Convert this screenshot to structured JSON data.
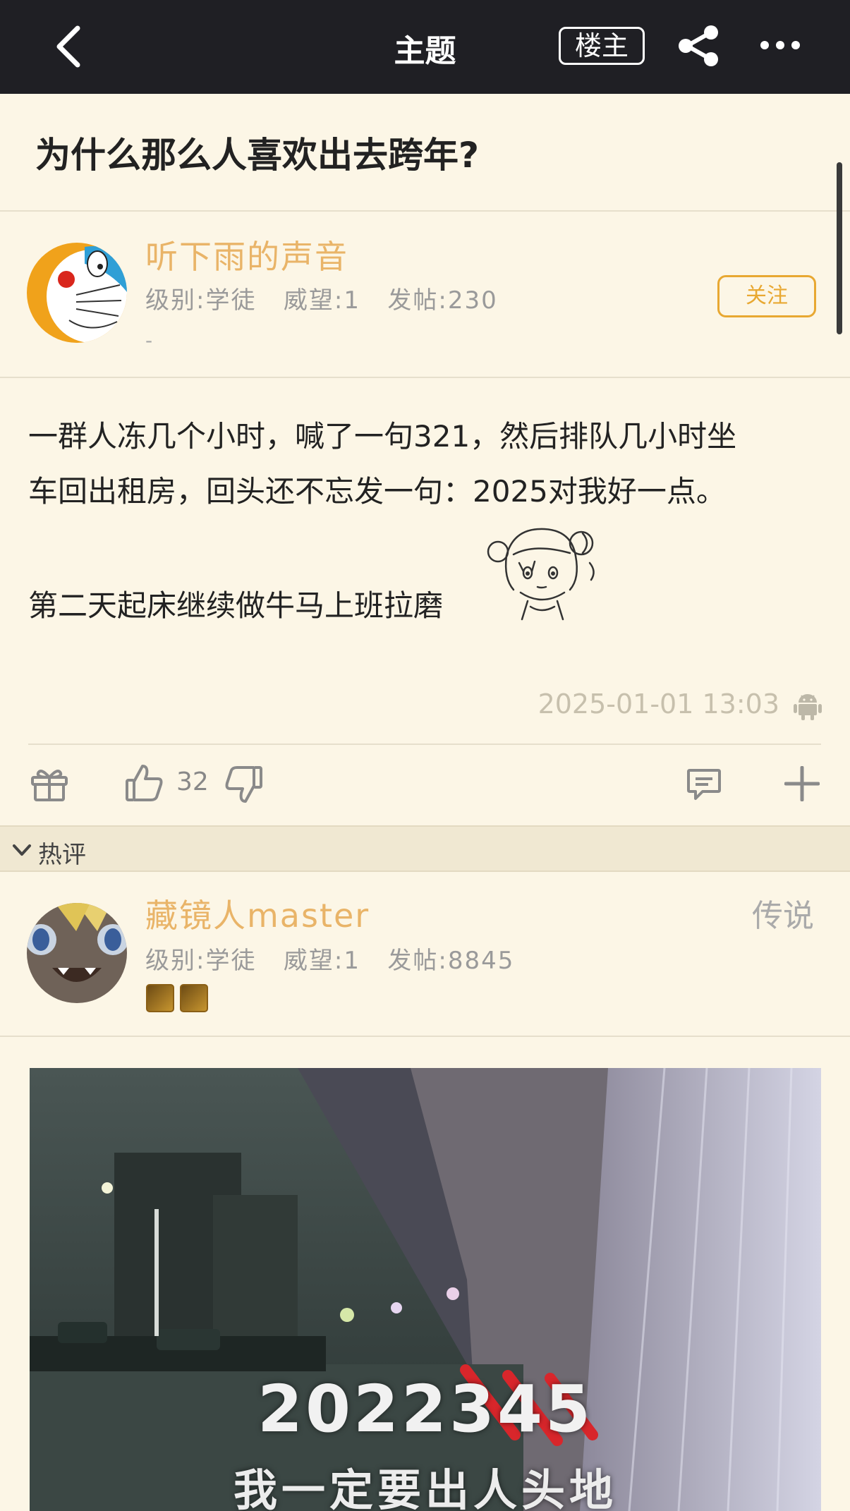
{
  "header": {
    "title": "主题",
    "op_filter_label": "楼主",
    "icons": [
      "chevron-left-icon",
      "share-icon",
      "more-icon"
    ]
  },
  "thread": {
    "title": "为什么那么人喜欢出去跨年?"
  },
  "op": {
    "username": "听下雨的声音",
    "meta": "级别:学徒   威望:1   发帖:230",
    "signature": "-",
    "follow_label": "关注"
  },
  "post": {
    "line1": "一群人冻几个小时，喊了一句321，然后排队几小时坐",
    "line2": "车回出租房，回头还不忘发一句：2025对我好一点。",
    "line3": "第二天起床继续做牛马上班拉磨",
    "timestamp": "2025-01-01 13:03"
  },
  "actions": {
    "like_count": "32",
    "icons": [
      "gift-icon",
      "thumbs-up-icon",
      "thumbs-down-icon",
      "comment-icon",
      "plus-icon"
    ]
  },
  "hot_section": {
    "label": "热评"
  },
  "reply": {
    "username": "藏镜人master",
    "meta": "级别:学徒   威望:1   发帖:8845",
    "rank": "传说",
    "image_number": "2022345",
    "image_caption": "我一定要出人头地"
  },
  "colors": {
    "background": "#fcf6e6",
    "topbar": "#1f1f24",
    "username": "#e9b468",
    "follow_accent": "#e8a832",
    "strike": "#d8262b"
  }
}
